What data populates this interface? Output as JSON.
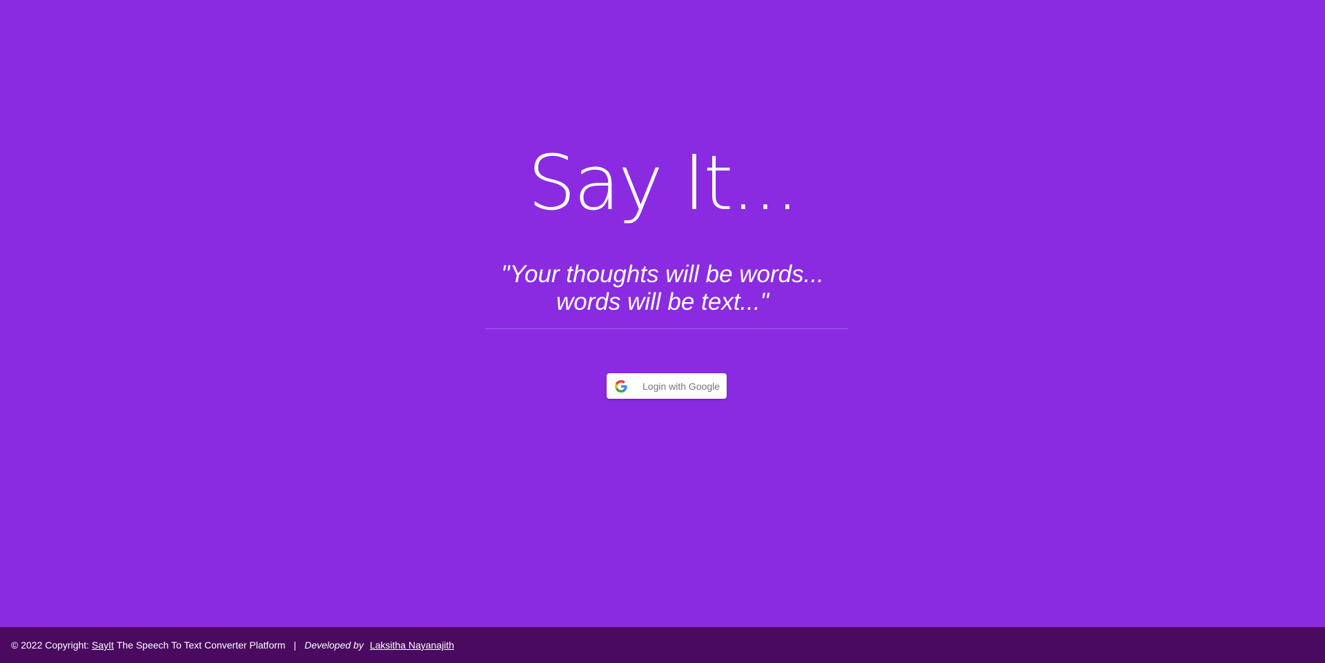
{
  "hero": {
    "title": "Say It...",
    "tagline_line1": "\"Your thoughts will be words...",
    "tagline_line2": "words will be text...\""
  },
  "login": {
    "label": "Login with Google",
    "icon": "google-icon"
  },
  "footer": {
    "copyright": "© 2022 Copyright:",
    "brand_link": "SayIt",
    "platform": "The Speech To Text Converter Platform",
    "separator": "|",
    "developed_by": "Developed by",
    "developer_link": "Laksitha Nayanajith"
  },
  "colors": {
    "background": "#8a2be2",
    "footer_background": "#4a0a60",
    "button_text": "#757575"
  }
}
